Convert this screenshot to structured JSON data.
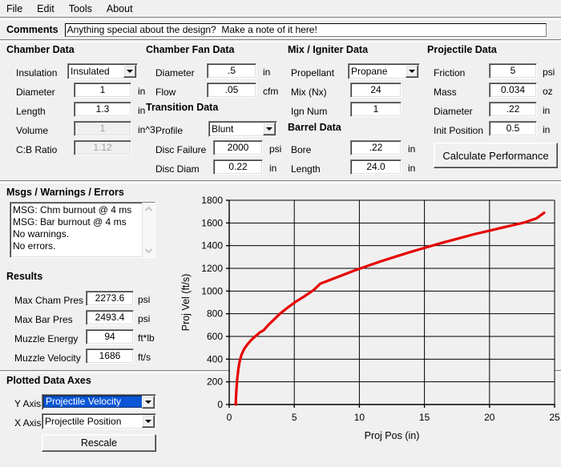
{
  "menubar": {
    "items": [
      {
        "label": "File"
      },
      {
        "label": "Edit"
      },
      {
        "label": "Tools"
      },
      {
        "label": "About"
      }
    ]
  },
  "comments": {
    "title": "Comments",
    "value": "Anything special about the design?  Make a note of it here!",
    "placeholder": "Anything special about the design?  Make a note of it here!"
  },
  "chamber_data": {
    "title": "Chamber Data",
    "insulation_label": "Insulation",
    "insulation_value": "Insulated",
    "diameter_label": "Diameter",
    "diameter_value": "1",
    "diameter_unit": "in",
    "length_label": "Length",
    "length_value": "1.3",
    "length_unit": "in",
    "volume_label": "Volume",
    "volume_value": "1",
    "volume_unit": "in^3",
    "cb_ratio_label": "C:B Ratio",
    "cb_ratio_value": "1.12"
  },
  "chamber_fan_data": {
    "title": "Chamber Fan Data",
    "diameter_label": "Diameter",
    "diameter_value": ".5",
    "diameter_unit": "in",
    "flow_label": "Flow",
    "flow_value": ".05",
    "flow_unit": "cfm"
  },
  "transition_data": {
    "title": "Transition Data",
    "profile_label": "Profile",
    "profile_value": "Blunt",
    "disc_failure_label": "Disc Failure",
    "disc_failure_value": "2000",
    "disc_failure_unit": "psi",
    "disc_diam_label": "Disc Diam",
    "disc_diam_value": "0.22",
    "disc_diam_unit": "in"
  },
  "mix_igniter_data": {
    "title": "Mix / Igniter Data",
    "propellant_label": "Propellant",
    "propellant_value": "Propane",
    "mix_label": "Mix (Nx)",
    "mix_value": "24",
    "ign_num_label": "Ign Num",
    "ign_num_value": "1"
  },
  "barrel_data": {
    "title": "Barrel Data",
    "bore_label": "Bore",
    "bore_value": ".22",
    "bore_unit": "in",
    "length_label": "Length",
    "length_value": "24.0",
    "length_unit": "in"
  },
  "projectile_data": {
    "title": "Projectile Data",
    "friction_label": "Friction",
    "friction_value": "5",
    "friction_unit": "psi",
    "mass_label": "Mass",
    "mass_value": "0.034",
    "mass_unit": "oz",
    "diameter_label": "Diameter",
    "diameter_value": ".22",
    "diameter_unit": "in",
    "init_position_label": "Init Position",
    "init_position_value": "0.5",
    "init_position_unit": "in",
    "calculate_button": "Calculate Performance"
  },
  "messages": {
    "title": "Msgs / Warnings / Errors",
    "lines": [
      "MSG: Chm burnout @ 4 ms",
      "MSG: Bar burnout @ 4 ms",
      "No warnings.",
      "No errors."
    ]
  },
  "results": {
    "title": "Results",
    "rows": [
      {
        "label": "Max Cham Pres",
        "value": "2273.6",
        "unit": "psi"
      },
      {
        "label": "Max Bar Pres",
        "value": "2493.4",
        "unit": "psi"
      },
      {
        "label": "Muzzle Energy",
        "value": "94",
        "unit": "ft*lb"
      },
      {
        "label": "Muzzle Velocity",
        "value": "1686",
        "unit": "ft/s"
      }
    ]
  },
  "plotted_axes": {
    "title": "Plotted Data Axes",
    "y_axis_label": "Y Axis",
    "y_axis_value": "Projectile Velocity",
    "x_axis_label": "X Axis",
    "x_axis_value": "Projectile Position",
    "rescale_button": "Rescale"
  },
  "chart_data": {
    "type": "line",
    "title": "",
    "xlabel": "Proj Pos (in)",
    "ylabel": "Proj Vel (ft/s)",
    "xlim": [
      0,
      25
    ],
    "ylim": [
      0,
      1800
    ],
    "xticks": [
      0,
      5,
      10,
      15,
      20,
      25
    ],
    "yticks": [
      0,
      200,
      400,
      600,
      800,
      1000,
      1200,
      1400,
      1600,
      1800
    ],
    "grid": true,
    "legend": false,
    "line_color": "#e60000",
    "series": [
      {
        "name": "Projectile Velocity",
        "x": [
          0.5,
          0.52,
          0.56,
          0.62,
          0.7,
          0.8,
          0.95,
          1.15,
          1.4,
          1.7,
          2.0,
          2.35,
          2.65,
          3.0,
          3.4,
          3.9,
          4.5,
          5.1,
          5.8,
          6.5,
          7.0,
          7.8,
          8.7,
          9.6,
          10.6,
          11.6,
          12.7,
          13.8,
          15.0,
          16.2,
          17.5,
          18.8,
          20.1,
          21.4,
          22.7,
          23.6,
          24.2
        ],
        "y": [
          0,
          60,
          140,
          230,
          310,
          380,
          440,
          490,
          530,
          570,
          600,
          635,
          655,
          700,
          745,
          800,
          855,
          905,
          955,
          1010,
          1065,
          1100,
          1140,
          1180,
          1220,
          1260,
          1300,
          1340,
          1380,
          1420,
          1460,
          1500,
          1535,
          1570,
          1605,
          1640,
          1690
        ]
      }
    ]
  }
}
